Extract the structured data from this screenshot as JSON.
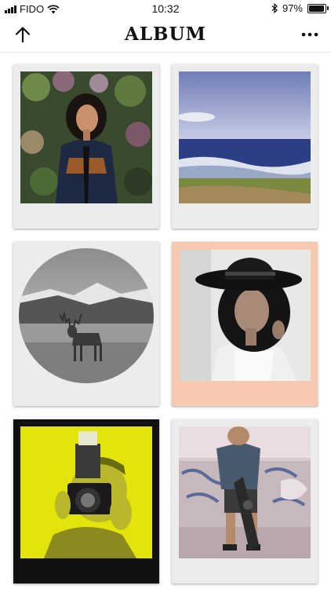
{
  "status_bar": {
    "carrier": "FIDO",
    "time": "10:32",
    "battery": "97%",
    "battery_level": 0.97
  },
  "header": {
    "title": "ALBUM",
    "back_icon": "arrow-up-icon",
    "menu_icon": "more-dots-icon"
  },
  "photos": [
    {
      "name": "portrait-woman-jacket",
      "frame": "white-polaroid"
    },
    {
      "name": "beach-seascape",
      "frame": "white-polaroid"
    },
    {
      "name": "deer-mountain-circle",
      "frame": "circle-polaroid"
    },
    {
      "name": "woman-black-hat",
      "frame": "peach-polaroid",
      "color": "#f7c9b0"
    },
    {
      "name": "photographer-camera",
      "frame": "black-polaroid",
      "color": "#e3e40a"
    },
    {
      "name": "skateboarder-graffiti",
      "frame": "white-polaroid"
    }
  ]
}
